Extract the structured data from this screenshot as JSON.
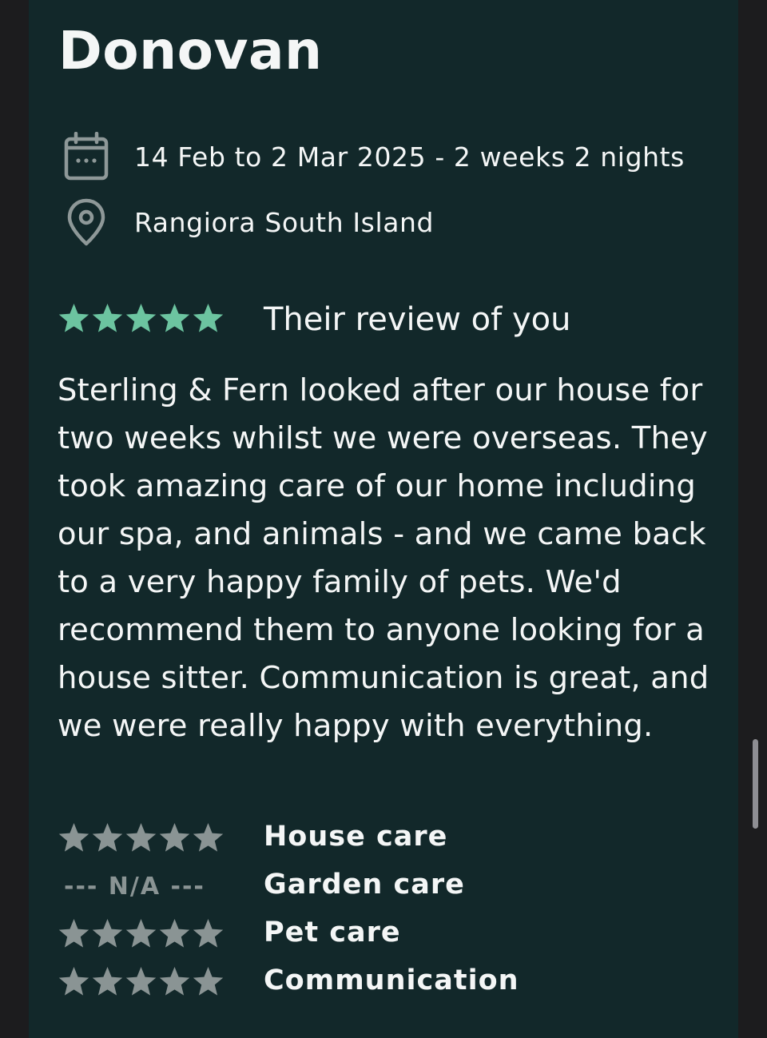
{
  "host": {
    "name": "Donovan"
  },
  "stay": {
    "dates": "14 Feb to 2 Mar 2025 - 2 weeks 2 nights",
    "location": "Rangiora South Island",
    "date_icon": "calendar-icon",
    "location_icon": "location-pin-icon"
  },
  "review": {
    "overall_rating": 5,
    "heading": "Their review of you",
    "text": "Sterling & Fern looked after our house for two weeks whilst we were overseas. They took amazing care of our home including our spa, and animals - and we came back to a very happy family of pets. We'd recommend them to anyone looking for a house sitter. Communication is great, and we were really happy with everything."
  },
  "ratings": [
    {
      "label": "House care",
      "stars": 5,
      "na_text": ""
    },
    {
      "label": "Garden care",
      "stars": null,
      "na_text": "--- N/A ---"
    },
    {
      "label": "Pet care",
      "stars": 5,
      "na_text": ""
    },
    {
      "label": "Communication",
      "stars": 5,
      "na_text": ""
    }
  ],
  "colors": {
    "card_background": "#12282a",
    "overall_star": "#6cc4a0",
    "category_star": "#8a9494",
    "text": "#f4f6f6"
  }
}
